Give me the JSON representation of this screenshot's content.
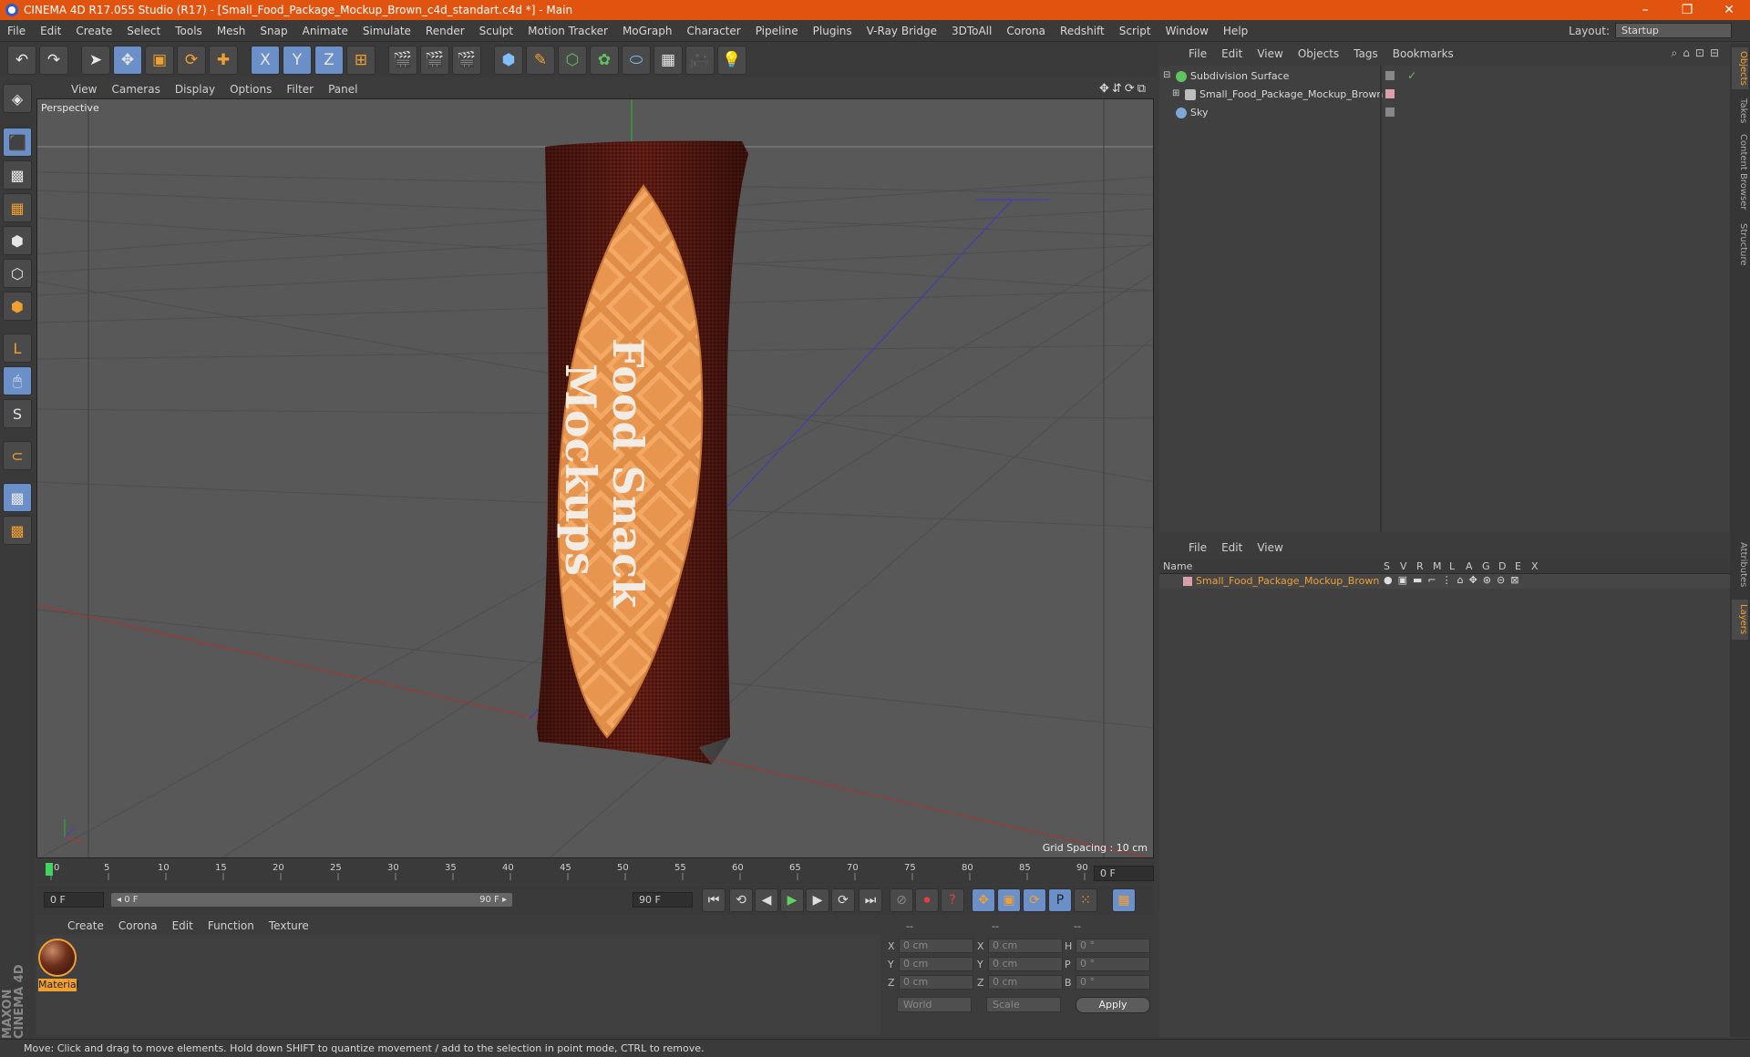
{
  "window": {
    "title": "CINEMA 4D R17.055 Studio (R17) - [Small_Food_Package_Mockup_Brown_c4d_standart.c4d *] - Main",
    "controls": [
      "–",
      "❐",
      "✕"
    ]
  },
  "menubar": {
    "items": [
      "File",
      "Edit",
      "Create",
      "Select",
      "Tools",
      "Mesh",
      "Snap",
      "Animate",
      "Simulate",
      "Render",
      "Sculpt",
      "Motion Tracker",
      "MoGraph",
      "Character",
      "Pipeline",
      "Plugins",
      "V-Ray Bridge",
      "3DToAll",
      "Corona",
      "Redshift",
      "Script",
      "Window",
      "Help"
    ],
    "layout_label": "Layout:",
    "layout_value": "Startup"
  },
  "toolbar": {
    "icons": [
      "↶",
      "↷",
      "➤",
      "✥",
      "▣",
      "⟳",
      "✚",
      "X",
      "Y",
      "Z",
      "⊞",
      "🎬",
      "🎬",
      "🎬",
      "⬢",
      "✎",
      "⬡",
      "✿",
      "⬭",
      "▦",
      "🎥",
      "💡"
    ]
  },
  "left_tools": [
    "◈",
    "⬛",
    "▩",
    "▦",
    "⬢",
    "⬡",
    "⬢",
    "L",
    "🖱",
    "S",
    "⊂",
    "▩",
    "▩"
  ],
  "viewport": {
    "menu": [
      "View",
      "Cameras",
      "Display",
      "Options",
      "Filter",
      "Panel"
    ],
    "nav_icons": "✥⇵⟳⧉",
    "label": "Perspective",
    "grid_spacing": "Grid Spacing : 10 cm",
    "package_text_line1": "Food Snack",
    "package_text_line2": "Mockups"
  },
  "timeline": {
    "ticks": [
      "0",
      "5",
      "10",
      "15",
      "20",
      "25",
      "30",
      "35",
      "40",
      "45",
      "50",
      "55",
      "60",
      "65",
      "70",
      "75",
      "80",
      "85",
      "90"
    ],
    "current_frame": "0 F",
    "start_field": "0 F",
    "range_start": "◂ 0 F",
    "range_end": "90 F ▸",
    "end_field": "90 F",
    "transport_icons": [
      "⏮",
      "⟲",
      "◀",
      "▶",
      "▶",
      "⟳",
      "⏭",
      "⊘",
      "⏺",
      "?",
      "✥",
      "▣",
      "⟳",
      "P",
      "⁙",
      "▦"
    ]
  },
  "materials": {
    "menu": [
      "Create",
      "Corona",
      "Edit",
      "Function",
      "Texture"
    ],
    "items": [
      {
        "name": "Material"
      }
    ],
    "maxon": "MAXON CINEMA 4D"
  },
  "coordinates": {
    "headers": [
      "--",
      "--",
      "--"
    ],
    "rows": [
      {
        "a": "X",
        "av": "0 cm",
        "b": "X",
        "bv": "0 cm",
        "c": "H",
        "cv": "0 °"
      },
      {
        "a": "Y",
        "av": "0 cm",
        "b": "Y",
        "bv": "0 cm",
        "c": "P",
        "cv": "0 °"
      },
      {
        "a": "Z",
        "av": "0 cm",
        "b": "Z",
        "bv": "0 cm",
        "c": "B",
        "cv": "0 °"
      }
    ],
    "mode": "World",
    "type": "Scale",
    "apply": "Apply"
  },
  "object_manager": {
    "menu": [
      "File",
      "Edit",
      "View",
      "Objects",
      "Tags",
      "Bookmarks"
    ],
    "header_icons": "⌕⌂⊡⊟",
    "objects": [
      {
        "name": "Subdivision Surface",
        "color": "#5fc35f",
        "indent": 0,
        "expand": "⊟",
        "check": "✓"
      },
      {
        "name": "Small_Food_Package_Mockup_Brown",
        "color": "#bdbdbd",
        "indent": 12,
        "expand": "⊞",
        "check": ""
      },
      {
        "name": "Sky",
        "color": "#7ea6d8",
        "indent": 0,
        "expand": "",
        "check": ""
      }
    ]
  },
  "layer_manager": {
    "menu": [
      "File",
      "Edit",
      "View"
    ],
    "columns": [
      "Name",
      "S",
      "V",
      "R",
      "M",
      "L",
      "A",
      "G",
      "D",
      "E",
      "X"
    ],
    "layers": [
      {
        "name": "Small_Food_Package_Mockup_Brown",
        "icons": "●▣▬⌐⋮⌂✥⊛⊝⊠"
      }
    ]
  },
  "right_tabs": [
    "Objects",
    "Takes",
    "Content Browser",
    "Structure",
    "Attributes",
    "Layers"
  ],
  "status": "Move: Click and drag to move elements. Hold down SHIFT to quantize movement / add to the selection in point mode, CTRL to remove."
}
